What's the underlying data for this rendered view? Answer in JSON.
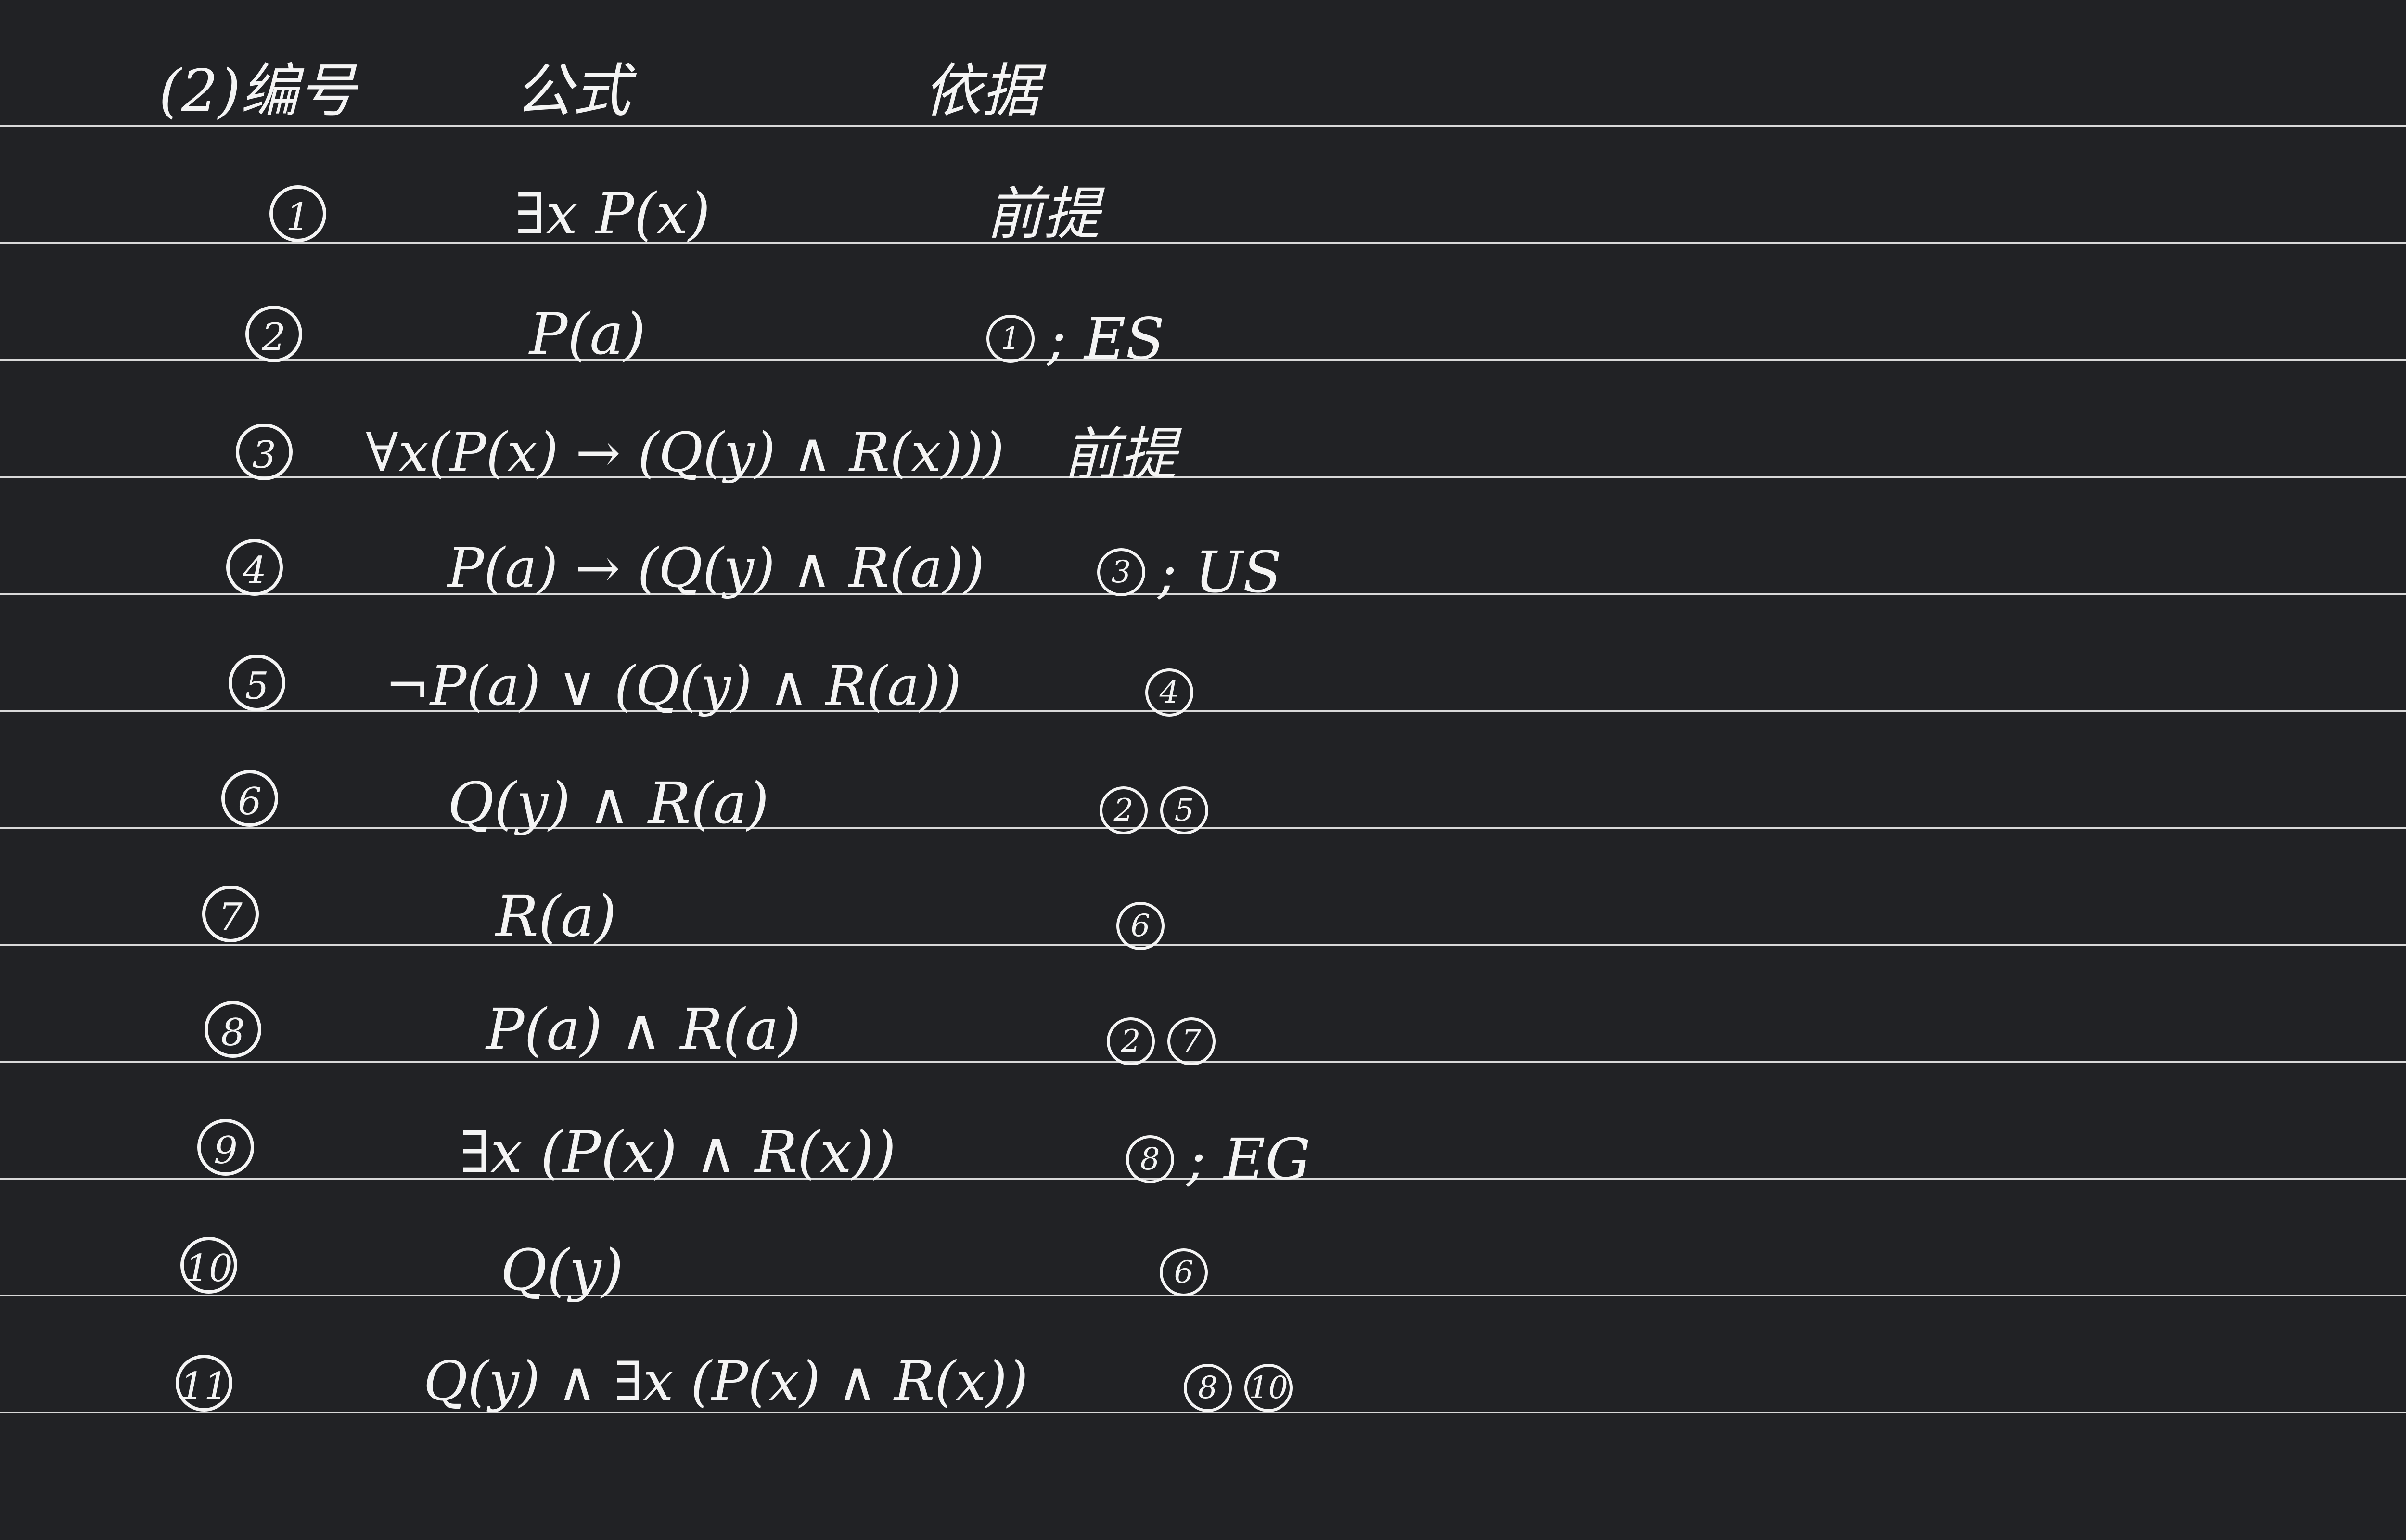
{
  "header": {
    "problem_label": "(2)",
    "col_number": "编号",
    "col_formula": "公式",
    "col_basis": "依据"
  },
  "rows": [
    {
      "num": "1",
      "formula": "∃x P(x)",
      "basis_refs": [],
      "basis_text": "前提"
    },
    {
      "num": "2",
      "formula": "P(a)",
      "basis_refs": [
        "1"
      ],
      "basis_text": "; ES"
    },
    {
      "num": "3",
      "formula": "∀x(P(x) → (Q(y) ∧ R(x)))",
      "basis_refs": [],
      "basis_text": "前提"
    },
    {
      "num": "4",
      "formula": "P(a) → (Q(y) ∧ R(a))",
      "basis_refs": [
        "3"
      ],
      "basis_text": "; US"
    },
    {
      "num": "5",
      "formula": "¬P(a) ∨ (Q(y) ∧ R(a))",
      "basis_refs": [
        "4"
      ],
      "basis_text": ""
    },
    {
      "num": "6",
      "formula": "Q(y) ∧ R(a)",
      "basis_refs": [
        "2",
        "5"
      ],
      "basis_text": ""
    },
    {
      "num": "7",
      "formula": "R(a)",
      "basis_refs": [
        "6"
      ],
      "basis_text": ""
    },
    {
      "num": "8",
      "formula": "P(a) ∧ R(a)",
      "basis_refs": [
        "2",
        "7"
      ],
      "basis_text": ""
    },
    {
      "num": "9",
      "formula": "∃x (P(x) ∧ R(x))",
      "basis_refs": [
        "8"
      ],
      "basis_text": "; EG"
    },
    {
      "num": "10",
      "formula": "Q(y)",
      "basis_refs": [
        "6"
      ],
      "basis_text": ""
    },
    {
      "num": "11",
      "formula": "Q(y) ∧ ∃x (P(x) ∧ R(x))",
      "basis_refs": [
        "8",
        "10"
      ],
      "basis_text": ""
    }
  ]
}
